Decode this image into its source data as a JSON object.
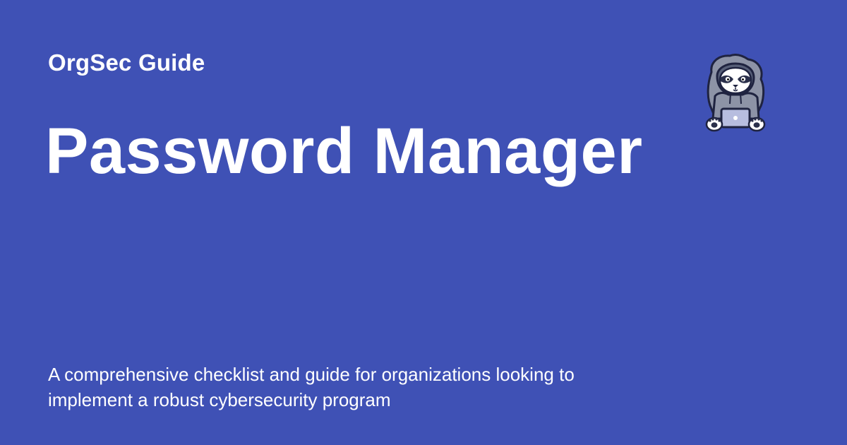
{
  "site": {
    "name": "OrgSec Guide"
  },
  "page": {
    "title": "Password Manager",
    "description": "A comprehensive checklist and guide for organizations looking to implement a robust cybersecurity program"
  },
  "mascot": {
    "icon": "hooded-raccoon-laptop-icon"
  },
  "colors": {
    "background": "#3f51b5",
    "text": "#ffffff"
  }
}
